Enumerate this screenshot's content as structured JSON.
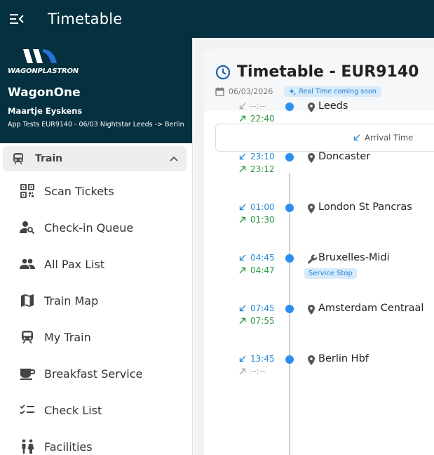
{
  "topbar": {
    "title": "Timetable"
  },
  "brand": {
    "logo_text": "WAGONPLASTRON",
    "name": "WagonOne",
    "user": "Maartje Eyskens",
    "trip": "App Tests EUR9140 - 06/03 Nightstar Leeds -> Berlin"
  },
  "sidebar": {
    "section": {
      "label": "Train",
      "icon": "train-icon"
    },
    "items": [
      {
        "label": "Scan Tickets",
        "icon": "qr-icon"
      },
      {
        "label": "Check-in Queue",
        "icon": "person-search-icon"
      },
      {
        "label": "All Pax List",
        "icon": "people-icon"
      },
      {
        "label": "Train Map",
        "icon": "map-icon"
      },
      {
        "label": "My Train",
        "icon": "train-icon"
      },
      {
        "label": "Breakfast Service",
        "icon": "coffee-icon"
      },
      {
        "label": "Check List",
        "icon": "checklist-icon"
      },
      {
        "label": "Facilities",
        "icon": "wc-icon"
      }
    ]
  },
  "main": {
    "title": "Timetable - EUR9140",
    "date": "06/03/2026",
    "realtime_badge": "Real Time coming soon",
    "filter": {
      "arrival_label": "Arrival Time"
    },
    "stops": [
      {
        "name": "Leeds",
        "arrival": "--:--",
        "departure": "22:40",
        "icon": "pin-icon"
      },
      {
        "name": "Doncaster",
        "arrival": "23:10",
        "departure": "23:12",
        "icon": "pin-icon"
      },
      {
        "name": "London St Pancras",
        "arrival": "01:00",
        "departure": "01:30",
        "icon": "pin-icon"
      },
      {
        "name": "Bruxelles-Midi",
        "arrival": "04:45",
        "departure": "04:47",
        "icon": "wrench-icon",
        "badge": "Service Stop"
      },
      {
        "name": "Amsterdam Centraal",
        "arrival": "07:45",
        "departure": "07:55",
        "icon": "pin-icon"
      },
      {
        "name": "Berlin Hbf",
        "arrival": "13:45",
        "departure": "--:--",
        "icon": "pin-icon"
      }
    ]
  },
  "colors": {
    "header_bg": "#04303f",
    "arrival": "#2a8bd8",
    "departure": "#2e9a3e",
    "dot": "#2a8ff0"
  }
}
